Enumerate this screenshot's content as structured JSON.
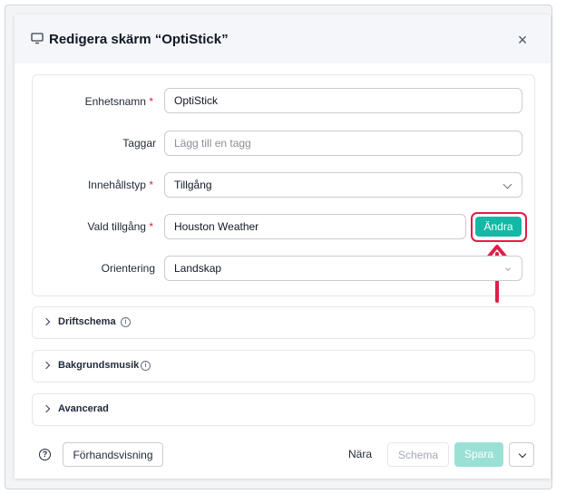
{
  "dialog": {
    "title": "Redigera skärm  “OptiStick”",
    "title_icon": "monitor-icon",
    "close_icon": "close-icon"
  },
  "form": {
    "device_name": {
      "label": "Enhetsnamn",
      "required": "*",
      "value": "OptiStick"
    },
    "tags": {
      "label": "Taggar",
      "placeholder": "Lägg till en tagg"
    },
    "content_type": {
      "label": "Innehållstyp",
      "required": "*",
      "value": "Tillgång"
    },
    "asset": {
      "label": "Vald tillgång",
      "required": "*",
      "value": "Houston Weather",
      "change_label": "Ändra"
    },
    "orientation": {
      "label": "Orientering",
      "value": "Landskap"
    }
  },
  "sections": [
    {
      "label": "Driftschema",
      "info": "i"
    },
    {
      "label": "Bakgrundsmusik",
      "info": "i"
    },
    {
      "label": "Avancerad"
    }
  ],
  "footer": {
    "help": "?",
    "preview_label": "Förhandsvisning",
    "close_label": "Nära",
    "schedule_label": "Schema",
    "save_label": "Spara"
  },
  "colors": {
    "accent": "#14b8a6",
    "highlight": "#e11d48",
    "required": "#e11d48"
  }
}
